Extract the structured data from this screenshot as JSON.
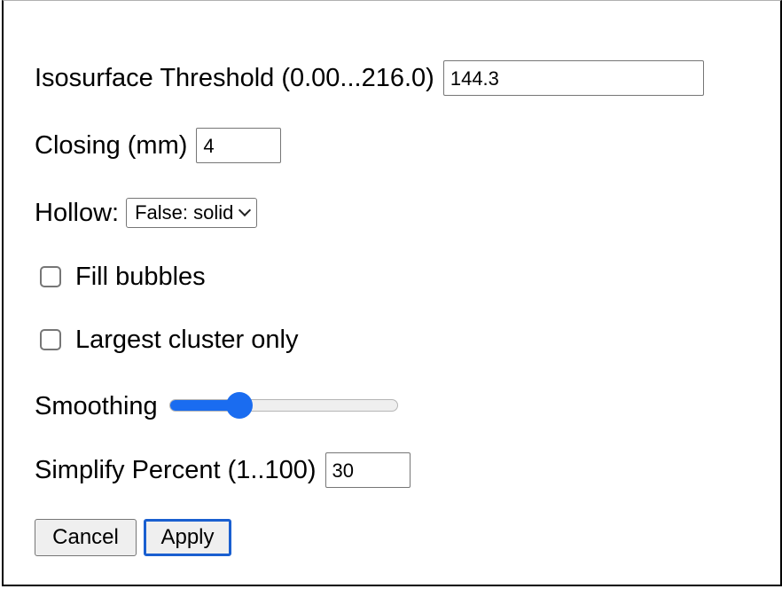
{
  "form": {
    "threshold_label": "Isosurface Threshold (0.00...216.0)",
    "threshold_value": "144.3",
    "closing_label": "Closing (mm)",
    "closing_value": "4",
    "hollow_label": "Hollow:",
    "hollow_selected": "False: solid",
    "fill_bubbles_label": "Fill bubbles",
    "fill_bubbles_checked": false,
    "largest_cluster_label": "Largest cluster only",
    "largest_cluster_checked": false,
    "smoothing_label": "Smoothing",
    "smoothing_fraction": 0.28,
    "simplify_label": "Simplify Percent (1..100)",
    "simplify_value": "30"
  },
  "buttons": {
    "cancel_label": "Cancel",
    "apply_label": "Apply"
  },
  "colors": {
    "accent": "#1a6cf0",
    "focus_ring": "#1a5fd0",
    "button_bg": "#efefef"
  },
  "icons": {
    "select_chevron": "chevron-down-icon"
  }
}
